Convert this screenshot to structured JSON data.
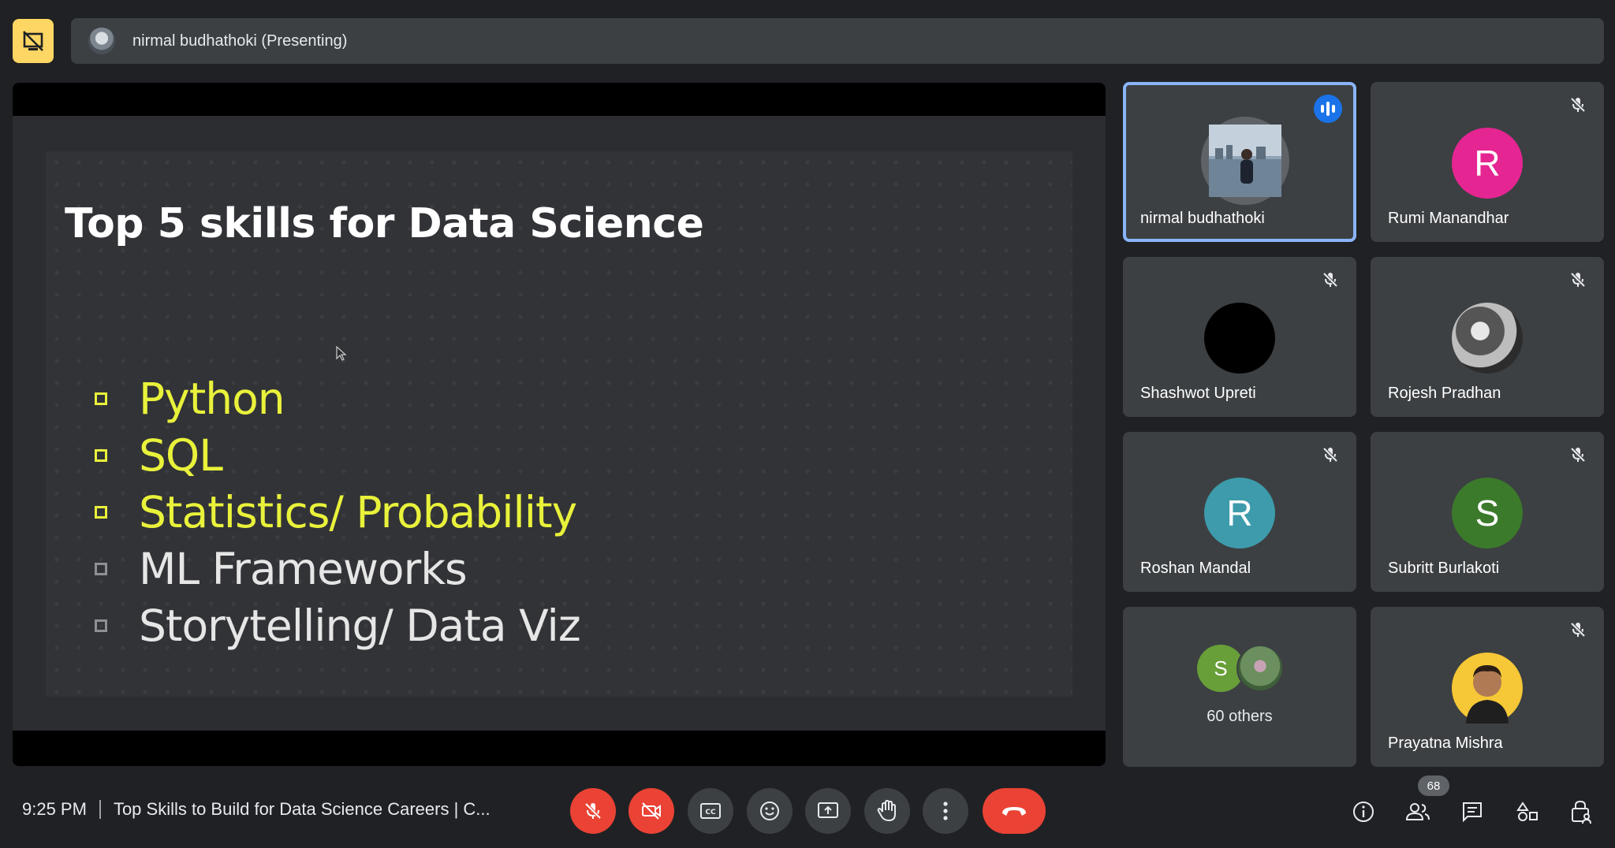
{
  "top_bar": {
    "presenter_label": "nirmal budhathoki (Presenting)",
    "present_icon": "stop-presenting-icon"
  },
  "slide": {
    "title": "Top 5 skills for Data Science",
    "bullets": [
      {
        "text": "Python",
        "highlighted": true
      },
      {
        "text": "SQL",
        "highlighted": true
      },
      {
        "text": "Statistics/ Probability",
        "highlighted": true
      },
      {
        "text": "ML Frameworks",
        "highlighted": false
      },
      {
        "text": "Storytelling/ Data Viz",
        "highlighted": false
      }
    ],
    "highlight_color": "#e9f23a"
  },
  "participants": [
    {
      "name": "nirmal budhathoki",
      "initial": "",
      "speaking": true,
      "muted": false
    },
    {
      "name": "Rumi Manandhar",
      "initial": "R",
      "color": "#e52592",
      "muted": true
    },
    {
      "name": "Shashwot Upreti",
      "initial": "",
      "color": "#000000",
      "muted": true
    },
    {
      "name": "Rojesh Pradhan",
      "initial": "",
      "color": "#8a8a8a",
      "muted": true
    },
    {
      "name": "Roshan Mandal",
      "initial": "R",
      "color": "#3d9bab",
      "muted": true
    },
    {
      "name": "Subritt Burlakoti",
      "initial": "S",
      "color": "#3b7a2a",
      "muted": true
    },
    {
      "name": "Prayatna Mishra",
      "initial": "",
      "color": "#f6c736",
      "muted": true
    }
  ],
  "others": {
    "initial": "S",
    "label": "60 others"
  },
  "bottom_bar": {
    "time": "9:25 PM",
    "meeting_title": "Top Skills to Build for Data Science Careers | C...",
    "people_count": "68"
  },
  "colors": {
    "background": "#202124",
    "tile": "#3c4043",
    "accent_blue": "#8ab4f8",
    "danger_red": "#ea4335"
  }
}
